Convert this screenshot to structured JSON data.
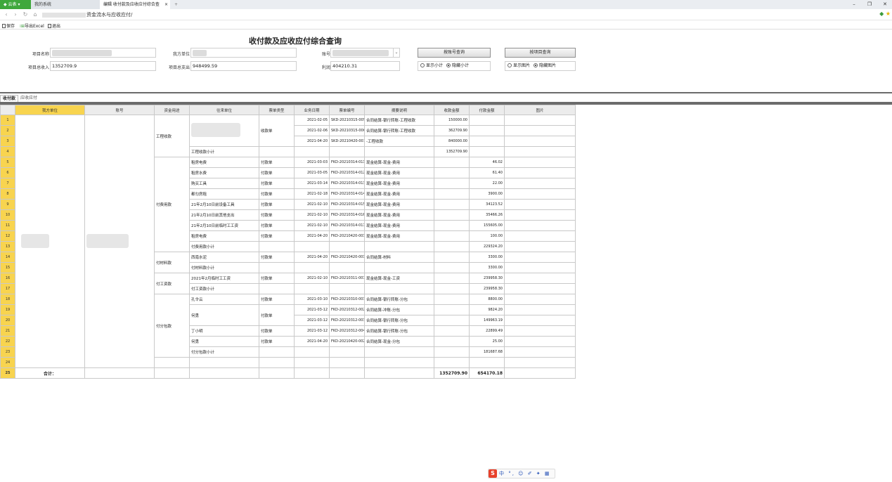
{
  "browser": {
    "tabs": [
      {
        "label": "云表"
      },
      {
        "label": "我的系统"
      },
      {
        "label": "编辑 收付款及应收应付综合查"
      }
    ],
    "active_tab_close": "×",
    "new_tab": "+",
    "url_text": "资金流水与应收应付/",
    "window_controls": {
      "minimize": "–",
      "restore": "❐",
      "close": "✕"
    }
  },
  "toolbar": {
    "save": "保存",
    "export": "导出Excel",
    "exit": "退出"
  },
  "form": {
    "title": "收付款及应收应付综合查询",
    "project_name_label": "项目名称",
    "own_unit_label": "我方单位",
    "account_label": "账号",
    "query_by_account": "按账号查询",
    "query_by_project": "按项目查询",
    "total_income_label": "项目总收入",
    "total_income_value": "1352709.9",
    "total_expense_label": "项目总支出",
    "total_expense_value": "948499.59",
    "profit_label": "利润",
    "profit_value": "404210.31",
    "subtotal_options": {
      "show": "显示小计",
      "hide": "隐藏小计",
      "selected": "hide"
    },
    "image_options": {
      "show": "显示图片",
      "hide": "隐藏图片",
      "selected": "hide"
    }
  },
  "sheet_tabs": [
    "收付款",
    "应收应付"
  ],
  "grid": {
    "headers": [
      "我方单位",
      "账号",
      "资金用途",
      "往来单位",
      "票单类型",
      "业务日期",
      "票单编号",
      "摘要说明",
      "收款金额",
      "付款金额",
      "图片"
    ],
    "row_numbers": [
      "1",
      "2",
      "3",
      "4",
      "5",
      "6",
      "7",
      "8",
      "9",
      "10",
      "11",
      "12",
      "13",
      "14",
      "15",
      "16",
      "17",
      "18",
      "19",
      "20",
      "21",
      "22",
      "23",
      "24",
      "25"
    ],
    "groups": {
      "g1": "工程收款",
      "g2": "付费用款",
      "g3": "付材料款",
      "g4": "付工资款",
      "g5": "付分包款"
    },
    "rows": [
      {
        "unit": "",
        "type": "收款单",
        "date": "2021-02-05",
        "no": "SKD-20210315-005",
        "memo": "合同结算-银行转账-工程收款",
        "in": "150000.00",
        "out": ""
      },
      {
        "unit": "",
        "type": "",
        "date": "2021-02-06",
        "no": "SKD-20210315-006",
        "memo": "合同结算-银行转账-工程收款",
        "in": "362709.90",
        "out": ""
      },
      {
        "unit": "",
        "type": "",
        "date": "2021-04-20",
        "no": "SKD-20210420-001",
        "memo": "-工程收款",
        "in": "840000.00",
        "out": ""
      },
      {
        "unit": "工程收款小计",
        "type": "",
        "date": "",
        "no": "",
        "memo": "",
        "in": "1352709.90",
        "out": ""
      },
      {
        "unit": "租房电费",
        "type": "付款单",
        "date": "2021-03-03",
        "no": "FKD-20210314-011",
        "memo": "现金结算-现金-费用",
        "in": "",
        "out": "46.02"
      },
      {
        "unit": "租房水费",
        "type": "付款单",
        "date": "2021-03-05",
        "no": "FKD-20210314-012",
        "memo": "现金结算-现金-费用",
        "in": "",
        "out": "61.40"
      },
      {
        "unit": "购买工具",
        "type": "付款单",
        "date": "2021-03-14",
        "no": "FKD-20210314-013",
        "memo": "现金结算-现金-费用",
        "in": "",
        "out": "22.00"
      },
      {
        "unit": "都匀房租",
        "type": "付款单",
        "date": "2021-02-18",
        "no": "FKD-20210314-014",
        "memo": "现金结算-现金-费用",
        "in": "",
        "out": "3900.00"
      },
      {
        "unit": "21年2月10日前设备工具",
        "type": "付款单",
        "date": "2021-02-10",
        "no": "FKD-20210314-015",
        "memo": "现金结算-现金-费用",
        "in": "",
        "out": "34123.52"
      },
      {
        "unit": "21年2月10日前其他支出",
        "type": "付款单",
        "date": "2021-02-10",
        "no": "FKD-20210314-016",
        "memo": "现金结算-现金-费用",
        "in": "",
        "out": "35466.26"
      },
      {
        "unit": "21年2月10日前临时工工资",
        "type": "付款单",
        "date": "2021-02-10",
        "no": "FKD-20210314-017",
        "memo": "现金结算-现金-费用",
        "in": "",
        "out": "155605.00"
      },
      {
        "unit": "租房电费",
        "type": "付款单",
        "date": "2021-04-20",
        "no": "FKD-20210420-003",
        "memo": "现金结算-现金-费用",
        "in": "",
        "out": "100.00"
      },
      {
        "unit": "付费用款小计",
        "type": "",
        "date": "",
        "no": "",
        "memo": "",
        "in": "",
        "out": "229324.20"
      },
      {
        "unit": "西南水泥",
        "type": "付款单",
        "date": "2021-04-20",
        "no": "FKD-20210420-001",
        "memo": "合同结算-材料",
        "in": "",
        "out": "3300.00"
      },
      {
        "unit": "付材料款小计",
        "type": "",
        "date": "",
        "no": "",
        "memo": "",
        "in": "",
        "out": "3300.00"
      },
      {
        "unit": "2021年2月临时工工资",
        "type": "付款单",
        "date": "2021-02-10",
        "no": "FKD-20210311-007",
        "memo": "现金结算-现金-工资",
        "in": "",
        "out": "239958.30"
      },
      {
        "unit": "付工资款小计",
        "type": "",
        "date": "",
        "no": "",
        "memo": "",
        "in": "",
        "out": "239958.30"
      },
      {
        "unit": "孔令云",
        "type": "付款单",
        "date": "2021-03-10",
        "no": "FKD-20210310-003",
        "memo": "合同结算-银行转账-分包",
        "in": "",
        "out": "8800.00"
      },
      {
        "unit": "何勇",
        "type": "付款单",
        "date": "2021-03-12",
        "no": "FKD-20210312-002",
        "memo": "合同结算-冲账-分包",
        "in": "",
        "out": "9824.20"
      },
      {
        "unit": "",
        "type": "",
        "date": "2021-03-12",
        "no": "FKD-20210312-003",
        "memo": "合同结算-银行转账-分包",
        "in": "",
        "out": "149963.19"
      },
      {
        "unit": "丁小明",
        "type": "付款单",
        "date": "2021-03-12",
        "no": "FKD-20210312-004",
        "memo": "合同结算-银行转账-分包",
        "in": "",
        "out": "22899.49"
      },
      {
        "unit": "何勇",
        "type": "付款单",
        "date": "2021-04-20",
        "no": "FKD-20210420-002",
        "memo": "合同结算-现金-分包",
        "in": "",
        "out": "25.00"
      },
      {
        "unit": "付分包款小计",
        "type": "",
        "date": "",
        "no": "",
        "memo": "",
        "in": "",
        "out": "181687.68"
      },
      {
        "unit": "",
        "type": "",
        "date": "",
        "no": "",
        "memo": "",
        "in": "",
        "out": ""
      }
    ],
    "total_label": "合计：",
    "total_in": "1352709.90",
    "total_out": "654170.18"
  },
  "ime": {
    "logo": "S",
    "items": "中 °, ☺ ✐ ✦ ▦"
  }
}
